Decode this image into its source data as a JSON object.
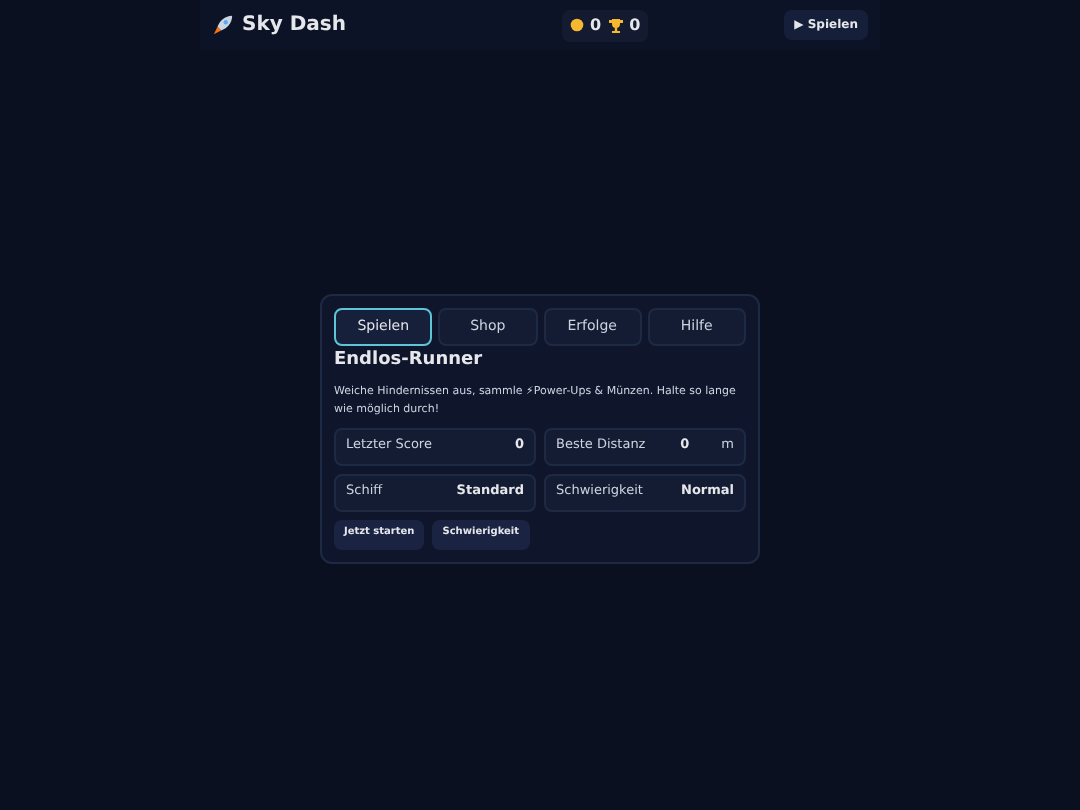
{
  "header": {
    "title": "Sky Dash",
    "coins": "0",
    "trophies": "0",
    "play_button": "▶ Spielen"
  },
  "tabs": [
    {
      "label": "Spielen",
      "selected": true
    },
    {
      "label": "Shop",
      "selected": false
    },
    {
      "label": "Erfolge",
      "selected": false
    },
    {
      "label": "Hilfe",
      "selected": false
    }
  ],
  "panel": {
    "title": "Endlos-Runner",
    "description": "Weiche Hindernissen aus, sammle ⚡Power-Ups & Münzen. Halte so lange wie möglich durch!",
    "stats": [
      {
        "label": "Letzter Score",
        "value": "0"
      },
      {
        "label": "Beste Distanz",
        "value": "0",
        "unit": "m"
      },
      {
        "label": "Schiff",
        "value": "Standard"
      },
      {
        "label": "Schwierigkeit",
        "value": "Normal"
      }
    ],
    "buttons": [
      "Jetzt starten",
      "Schwierigkeit"
    ]
  }
}
